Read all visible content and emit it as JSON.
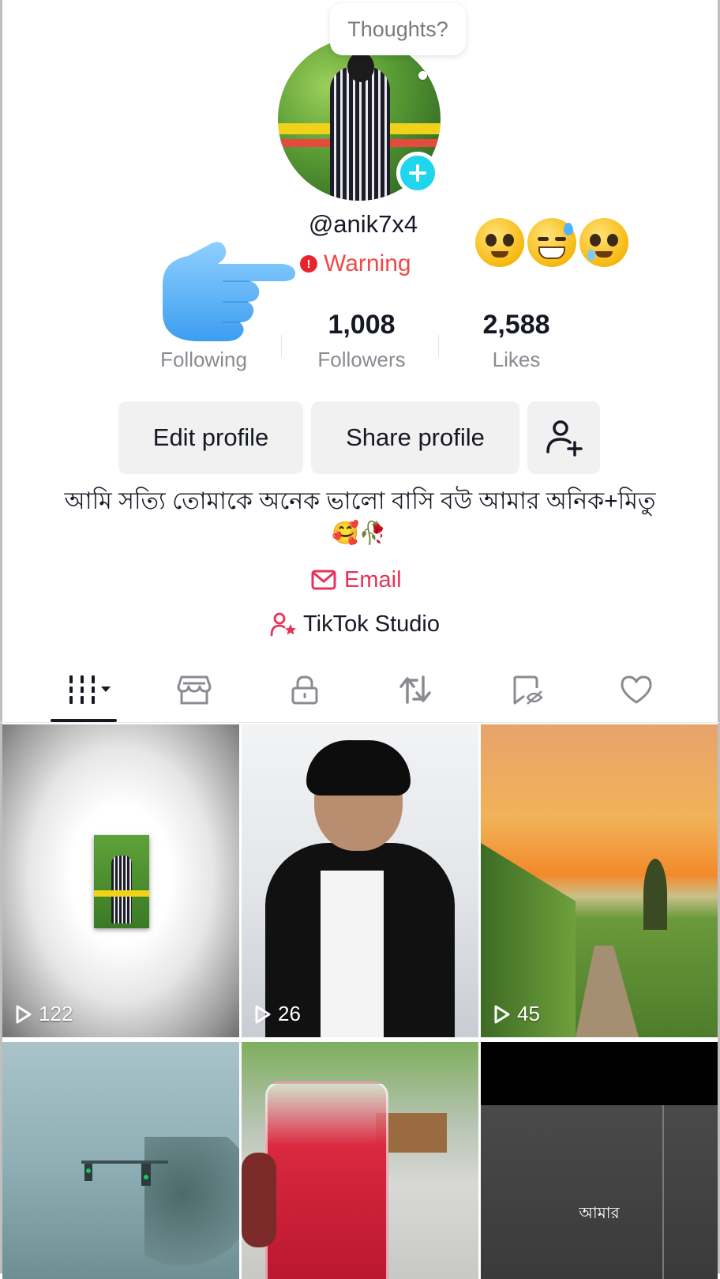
{
  "profile": {
    "thoughts_placeholder": "Thoughts?",
    "username": "@anik7x4",
    "warning_label": "Warning",
    "bio_line1": "আমি সত্যি তোমাকে অনেক ভালো বাসি বউ আমার অনিক+মিতু",
    "bio_emojis": "🥰🥀",
    "email_label": "Email",
    "studio_label": "TikTok Studio",
    "status_emojis": [
      "pleading-face",
      "grinning-sweat-face",
      "face-holding-back-tears"
    ]
  },
  "stats": {
    "following": {
      "value": "",
      "label": "Following"
    },
    "followers": {
      "value": "1,008",
      "label": "Followers"
    },
    "likes": {
      "value": "2,588",
      "label": "Likes"
    }
  },
  "actions": {
    "edit_label": "Edit profile",
    "share_label": "Share profile",
    "add_friend_icon": "add-person-icon"
  },
  "tabs": [
    {
      "icon": "videos-grid-icon",
      "active": true
    },
    {
      "icon": "shop-icon",
      "active": false
    },
    {
      "icon": "lock-icon",
      "active": false
    },
    {
      "icon": "repost-icon",
      "active": false
    },
    {
      "icon": "favorites-icon",
      "active": false
    },
    {
      "icon": "liked-heart-icon",
      "active": false
    }
  ],
  "videos": [
    {
      "views": "122"
    },
    {
      "views": "26"
    },
    {
      "views": "45"
    },
    {
      "views": ""
    },
    {
      "views": ""
    },
    {
      "views": "",
      "overlay_text": "আমার"
    }
  ],
  "colors": {
    "accent_red": "#e8325a",
    "warning_red": "#ef4a4a",
    "cyan_add": "#20d5ec",
    "button_bg": "#f1f1f2"
  }
}
